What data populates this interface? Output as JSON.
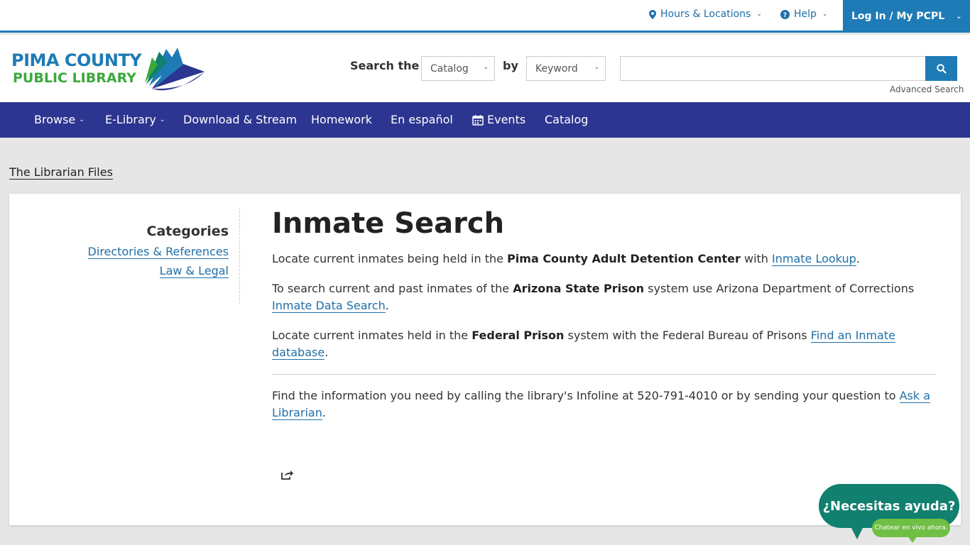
{
  "util": {
    "hours_label": "Hours & Locations",
    "help_label": "Help",
    "login_label": "Log In / My PCPL"
  },
  "logo": {
    "line1": "PIMA COUNTY",
    "line2": "PUBLIC LIBRARY"
  },
  "search": {
    "label": "Search the",
    "by_label": "by",
    "scope_selected": "Catalog",
    "type_selected": "Keyword",
    "query_value": "",
    "advanced_label": "Advanced Search"
  },
  "nav": {
    "items": [
      {
        "label": "Browse"
      },
      {
        "label": "E-Library"
      },
      {
        "label": "Download & Stream"
      },
      {
        "label": "Homework"
      },
      {
        "label": "En español"
      },
      {
        "label": "Events"
      },
      {
        "label": "Catalog"
      }
    ]
  },
  "breadcrumb": "The Librarian Files",
  "sidebar": {
    "heading": "Categories",
    "links": [
      {
        "label": "Directories & References"
      },
      {
        "label": "Law & Legal"
      }
    ]
  },
  "content": {
    "title": "Inmate Search",
    "p1": {
      "a": "Locate current inmates being held in the ",
      "b": "Pima County Adult Detention Center",
      "c": " with ",
      "link": "Inmate Lookup",
      "d": "."
    },
    "p2": {
      "a": "To search current and past inmates of the ",
      "b": "Arizona State Prison",
      "c": " system use Arizona Department of Corrections ",
      "link": "Inmate Data Search",
      "d": "."
    },
    "p3": {
      "a": "Locate current inmates held in the ",
      "b": "Federal Prison",
      "c": " system with the Federal Bureau of Prisons ",
      "link": "Find an Inmate database",
      "d": "."
    },
    "p4": {
      "a": "Find the information you need by calling the library's Infoline at 520-791-4010 or by sending your question to ",
      "link": "Ask a Librarian",
      "d": "."
    }
  },
  "chat": {
    "main": "¿Necesitas ayuda?",
    "sub": "Chatear en vivo ahora."
  },
  "colors": {
    "brand_blue": "#1f7bb6",
    "nav_bg": "#2c3691",
    "chat_green": "#12806e",
    "chat_light": "#6fbf44"
  }
}
